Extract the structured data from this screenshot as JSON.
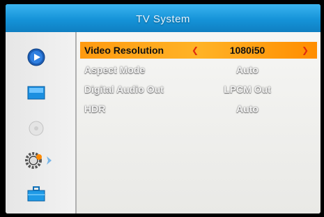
{
  "window": {
    "title": "TV System"
  },
  "sidebar": {
    "icons": [
      {
        "name": "play-icon"
      },
      {
        "name": "display-icon"
      },
      {
        "name": "disc-icon"
      },
      {
        "name": "gear-icon"
      },
      {
        "name": "briefcase-icon"
      }
    ],
    "selected_index": 3
  },
  "menu": {
    "items": [
      {
        "label": "Video Resolution",
        "value": "1080i50",
        "selected": true
      },
      {
        "label": "Aspect Mode",
        "value": "Auto",
        "selected": false
      },
      {
        "label": "Digital Audio Out",
        "value": "LPCM Out",
        "selected": false
      },
      {
        "label": "HDR",
        "value": "Auto",
        "selected": false
      }
    ]
  },
  "colors": {
    "title_bar": "#1593d8",
    "highlight": "#ffa61a",
    "arrow": "#e02a10"
  }
}
